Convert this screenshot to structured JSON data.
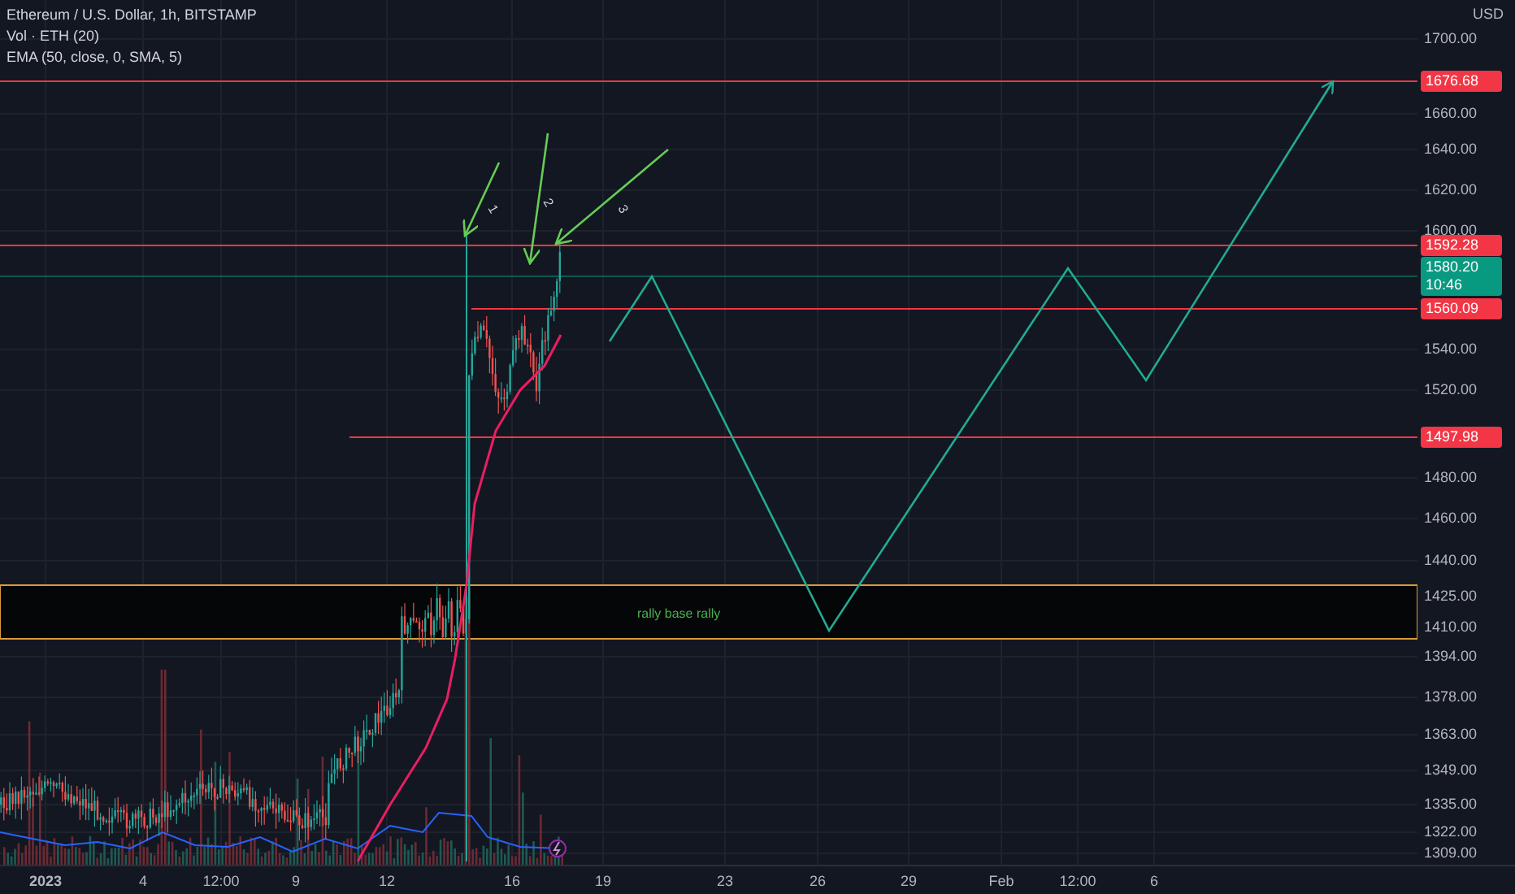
{
  "legend": [
    "Ethereum / U.S. Dollar, 1h, BITSTAMP",
    "Vol · ETH (20)",
    "EMA (50, close, 0, SMA, 5)"
  ],
  "price_axis": [
    {
      "kind": "unit",
      "text": "USD"
    },
    {
      "kind": "tick",
      "text": "1700.00"
    },
    {
      "kind": "tag",
      "text": "1676.68",
      "color": "#f23645"
    },
    {
      "kind": "tick",
      "text": "1660.00"
    },
    {
      "kind": "tick",
      "text": "1640.00"
    },
    {
      "kind": "tick",
      "text": "1620.00"
    },
    {
      "kind": "tick",
      "text": "1600.00"
    },
    {
      "kind": "tag",
      "text": "1592.28",
      "color": "#f23645"
    },
    {
      "kind": "tag",
      "text": "1580.20",
      "countdown": "10:46",
      "color": "#089981"
    },
    {
      "kind": "tag",
      "text": "1560.09",
      "color": "#f23645"
    },
    {
      "kind": "tick",
      "text": "1540.00"
    },
    {
      "kind": "tick",
      "text": "1520.00"
    },
    {
      "kind": "tag",
      "text": "1497.98",
      "color": "#f23645"
    },
    {
      "kind": "tick",
      "text": "1480.00"
    },
    {
      "kind": "tick",
      "text": "1460.00"
    },
    {
      "kind": "tick",
      "text": "1440.00"
    },
    {
      "kind": "tick",
      "text": "1425.00"
    },
    {
      "kind": "tick",
      "text": "1410.00"
    },
    {
      "kind": "tick",
      "text": "1394.00"
    },
    {
      "kind": "tick",
      "text": "1378.00"
    },
    {
      "kind": "tick",
      "text": "1363.00"
    },
    {
      "kind": "tick",
      "text": "1349.00"
    },
    {
      "kind": "tick",
      "text": "1335.00"
    },
    {
      "kind": "tick",
      "text": "1322.00"
    },
    {
      "kind": "tick",
      "text": "1309.00"
    }
  ],
  "time_axis": [
    {
      "text": "2023",
      "bold": true
    },
    {
      "text": "4",
      "bold": false
    },
    {
      "text": "12:00",
      "bold": false
    },
    {
      "text": "9",
      "bold": false
    },
    {
      "text": "12",
      "bold": false
    },
    {
      "text": "16",
      "bold": false
    },
    {
      "text": "19",
      "bold": false
    },
    {
      "text": "23",
      "bold": false
    },
    {
      "text": "26",
      "bold": false
    },
    {
      "text": "29",
      "bold": false
    },
    {
      "text": "Feb",
      "bold": false
    },
    {
      "text": "12:00",
      "bold": false
    },
    {
      "text": "6",
      "bold": false
    }
  ],
  "arrows": [
    {
      "label": "1"
    },
    {
      "label": "2"
    },
    {
      "label": "3"
    }
  ],
  "zone": {
    "label": "rally base rally"
  }
}
